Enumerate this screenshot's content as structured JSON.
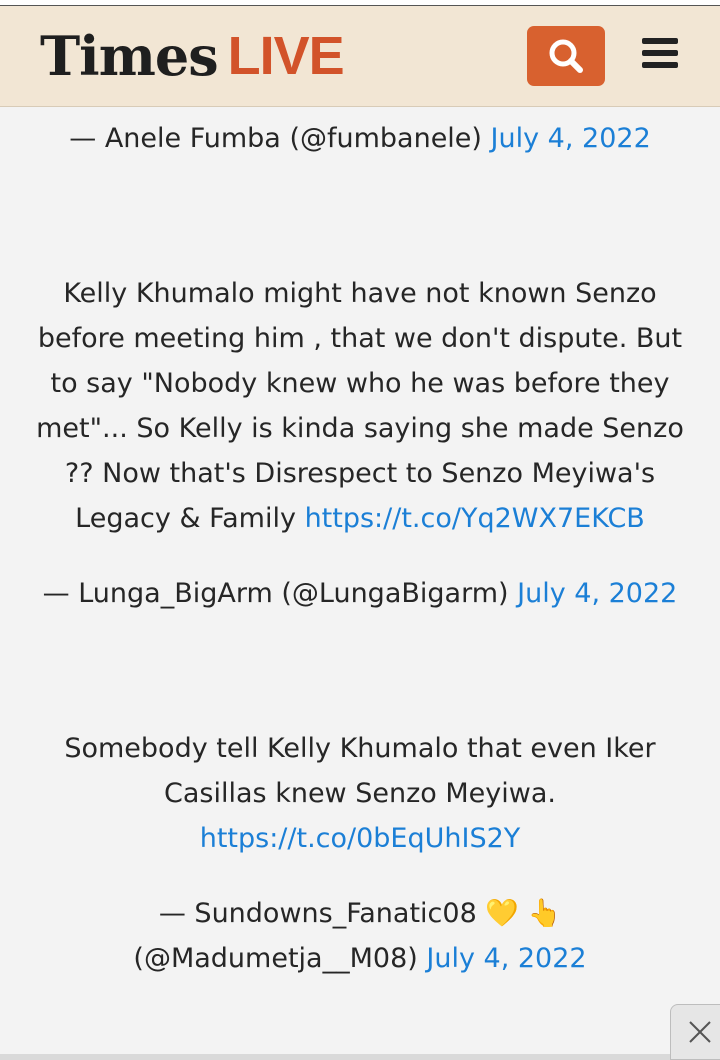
{
  "header": {
    "logo_main": "Times",
    "logo_accent": "LIVE",
    "search_icon": "search-icon",
    "menu_icon": "hamburger-menu-icon"
  },
  "tweets": [
    {
      "attribution_prefix": "— Anele Fumba (@fumbanele)",
      "date": "July 4, 2022"
    },
    {
      "body_lines": [
        "Kelly Khumalo might have not known Senzo",
        "before meeting him , that we don't dispute. But",
        "to say \"Nobody knew who he was before they",
        "met\"... So Kelly is kinda saying she made Senzo",
        "?? Now that's Disrespect to Senzo Meyiwa's"
      ],
      "body_last_text": "Legacy & Family",
      "link": "https://t.co/Yq2WX7EKCB",
      "attribution_prefix": "— Lunga_BigArm (@LungaBigarm)",
      "date": "July 4, 2022"
    },
    {
      "body_lines": [
        "Somebody tell Kelly Khumalo that even Iker",
        "Casillas knew Senzo Meyiwa."
      ],
      "link": "https://t.co/0bEqUhIS2Y",
      "attribution_line1": "— Sundowns_Fanatic08 💛 👆",
      "attribution_prefix": "(@Madumetja__M08)",
      "date": "July 4, 2022"
    }
  ],
  "close_icon": "close-icon",
  "colors": {
    "header_bg": "#f2e6d4",
    "brand_orange": "#d8612f",
    "link": "#1b7fd6"
  }
}
